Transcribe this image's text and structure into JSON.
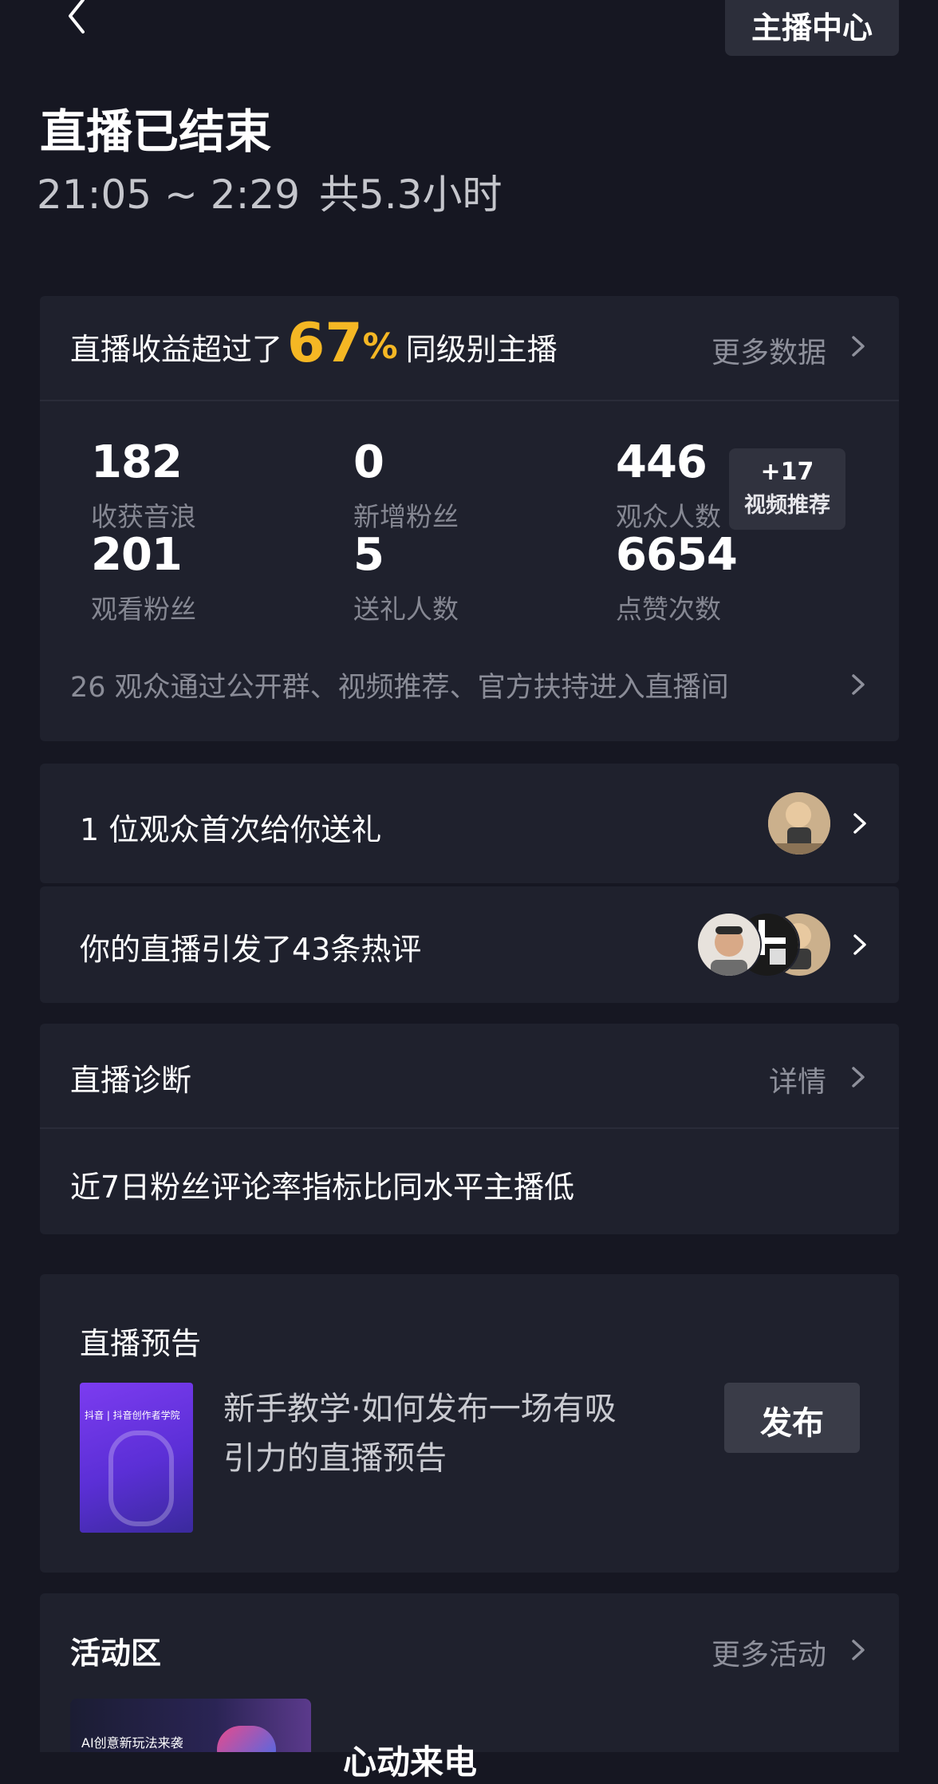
{
  "header": {
    "back_icon": "chevron-left-icon",
    "center_button": "主播中心",
    "title": "直播已结束",
    "time_range": "21:05 ~ 2:29",
    "duration": "共5.3小时"
  },
  "revenue": {
    "prefix": "直播收益超过了",
    "percent": "67",
    "percent_sign": "%",
    "suffix": "同级别主播",
    "more_link": "更多数据",
    "accent_color": "#f5b724"
  },
  "stats": [
    {
      "value": "182",
      "label": "收获音浪"
    },
    {
      "value": "0",
      "label": "新增粉丝"
    },
    {
      "value": "446",
      "label": "观众人数"
    },
    {
      "value": "201",
      "label": "观看粉丝"
    },
    {
      "value": "5",
      "label": "送礼人数"
    },
    {
      "value": "6654",
      "label": "点赞次数"
    }
  ],
  "badge": {
    "top": "+17",
    "bottom": "视频推荐"
  },
  "traffic_note": "26 观众通过公开群、视频推荐、官方扶持进入直播间",
  "gift_row": {
    "text": "1 位观众首次给你送礼"
  },
  "comment_row": {
    "text": "你的直播引发了43条热评"
  },
  "diagnosis": {
    "title": "直播诊断",
    "detail_link": "详情",
    "message": "近7日粉丝评论率指标比同水平主播低"
  },
  "preview": {
    "title": "直播预告",
    "description_line1": "新手教学·如何发布一场有吸",
    "description_line2": "引力的直播预告",
    "publish_button": "发布",
    "thumb_text": "抖音 | 抖音创作者学院"
  },
  "activities": {
    "title": "活动区",
    "more_link": "更多活动",
    "item_title": "心动来电",
    "thumb_text": "AI创意新玩法来袭"
  }
}
